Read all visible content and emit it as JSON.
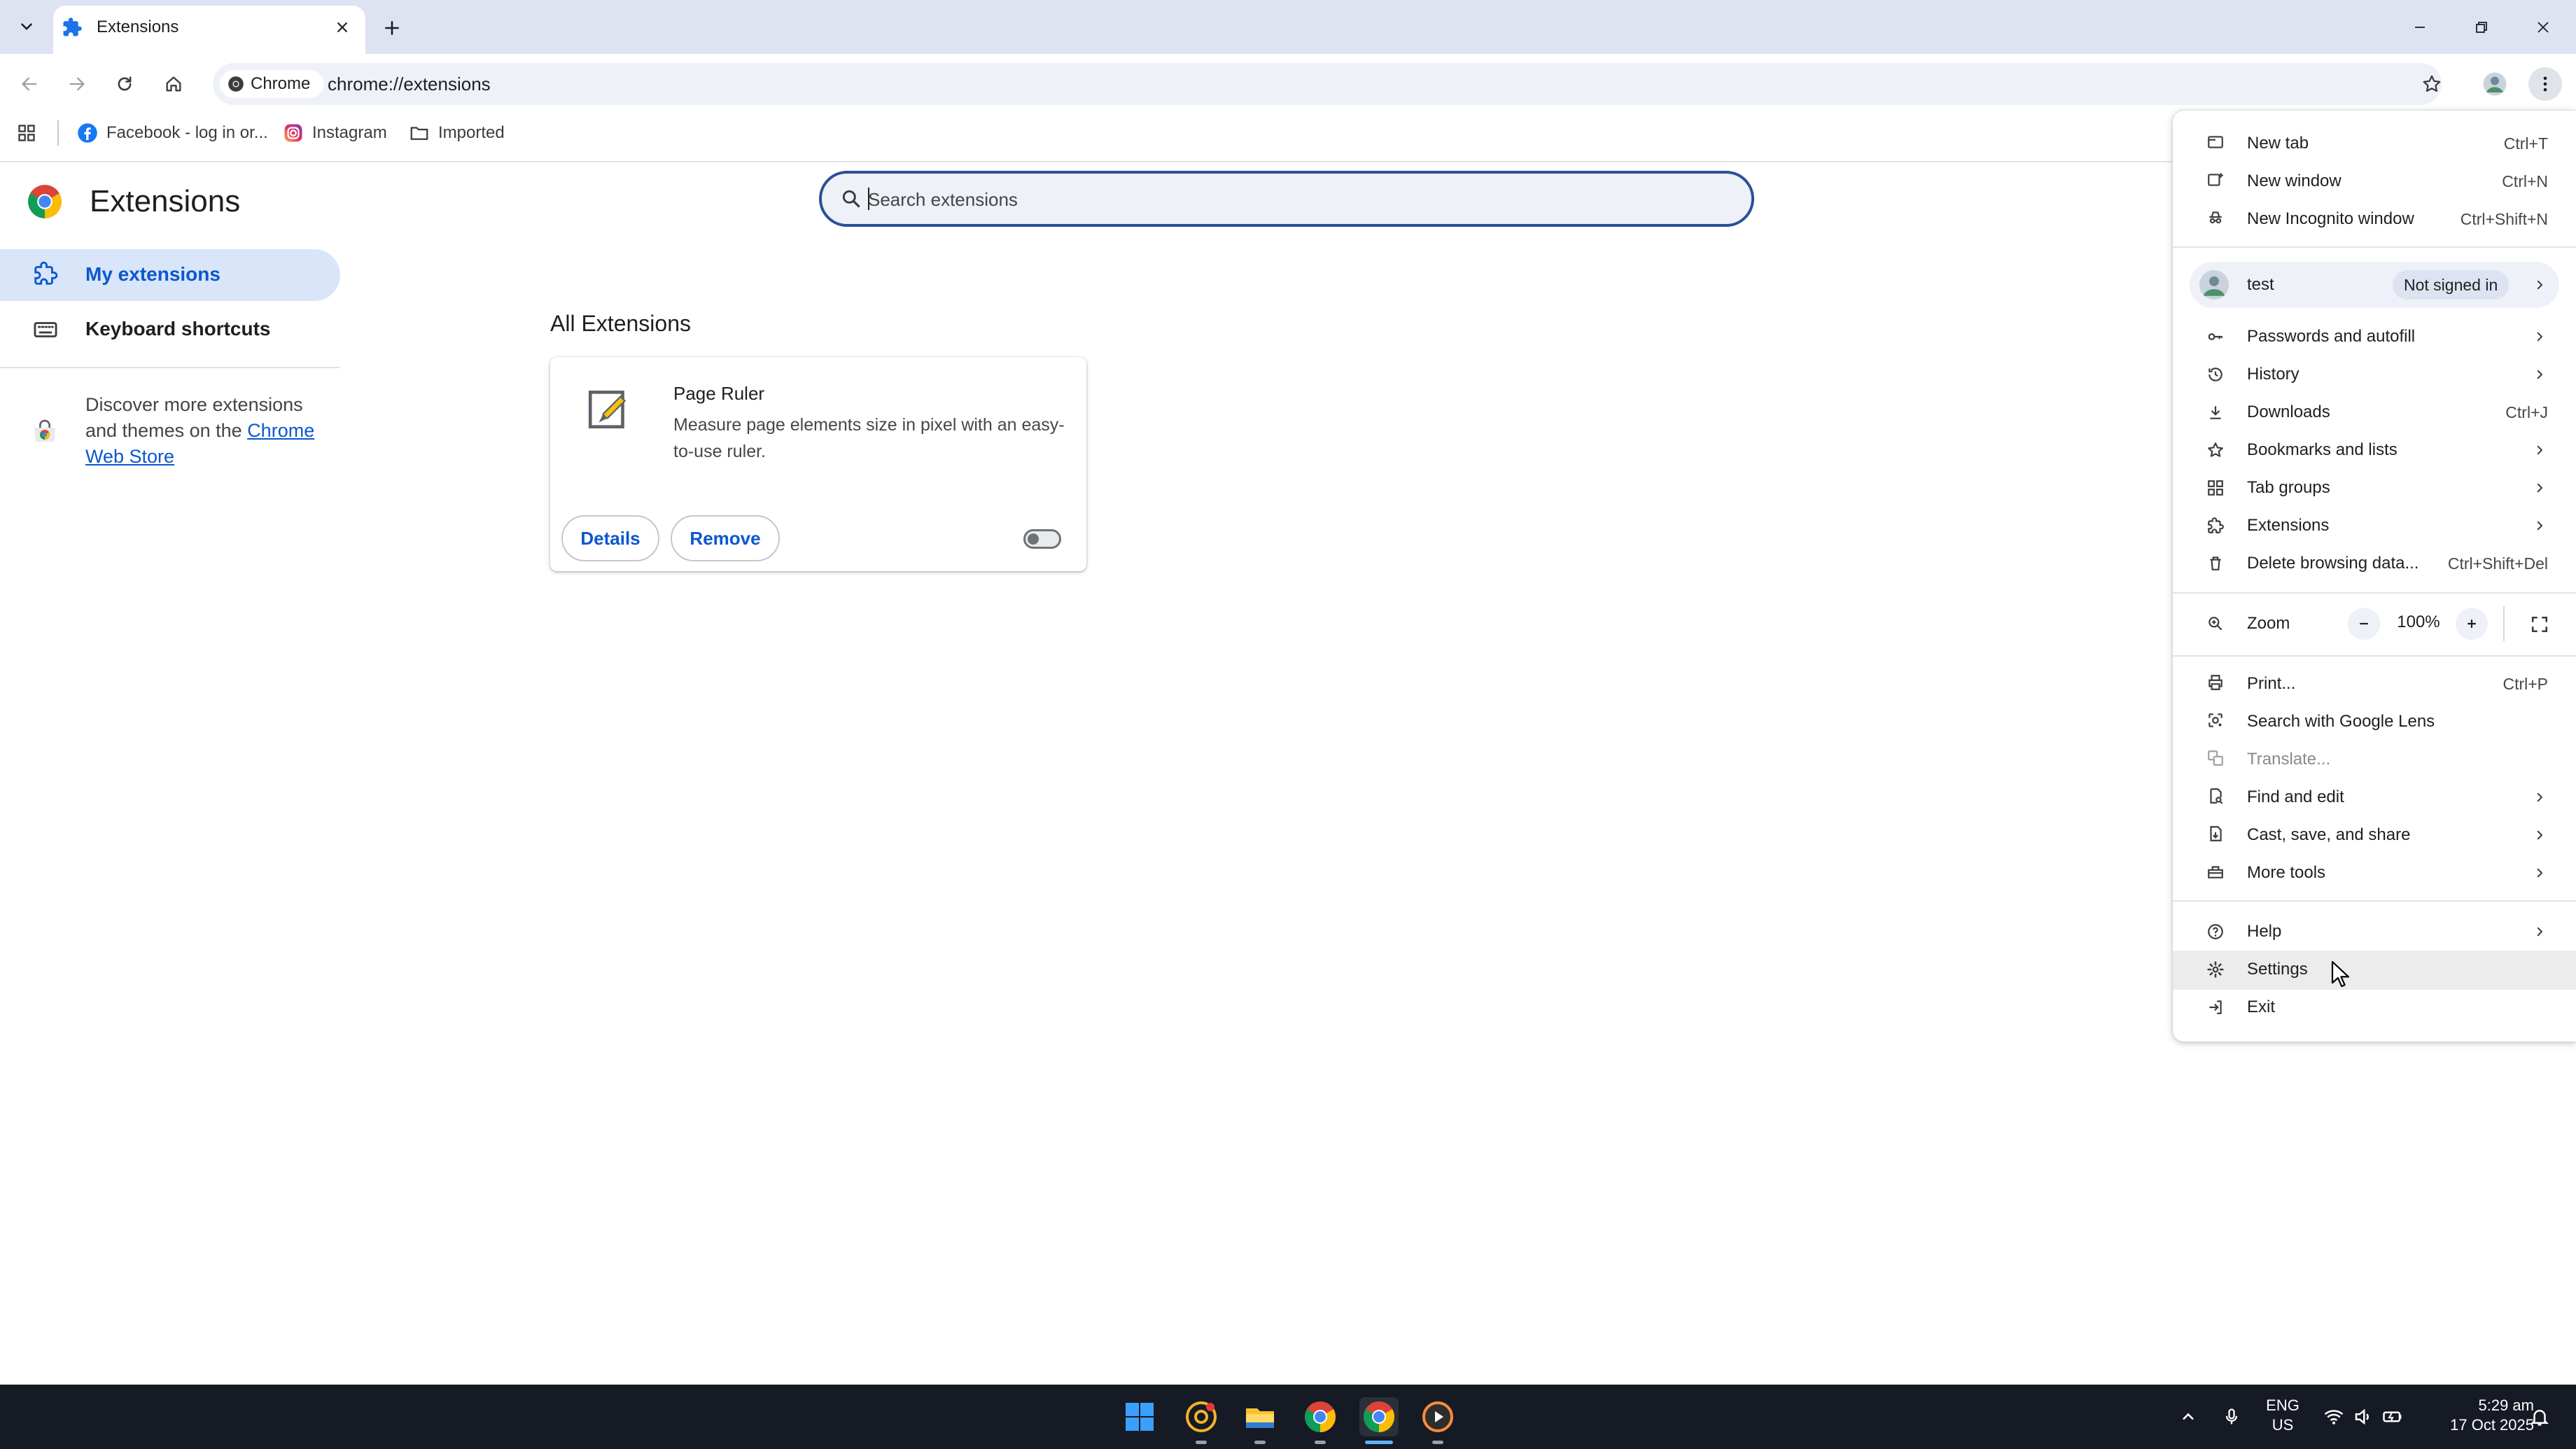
{
  "browser": {
    "tab": {
      "title": "Extensions"
    },
    "omnibox": {
      "chip_label": "Chrome",
      "url": "chrome://extensions"
    },
    "bookmarks": [
      {
        "label": "Facebook - log in or...",
        "icon": "facebook-icon"
      },
      {
        "label": "Instagram",
        "icon": "instagram-icon"
      },
      {
        "label": "Imported",
        "icon": "folder-icon"
      }
    ]
  },
  "page": {
    "title": "Extensions",
    "search_placeholder": "Search extensions",
    "nav": [
      {
        "label": "My extensions",
        "icon": "extensions-icon",
        "selected": true
      },
      {
        "label": "Keyboard shortcuts",
        "icon": "keyboard-icon",
        "selected": false
      }
    ],
    "discover_text": "Discover more extensions and themes on the",
    "webstore_link": "Chrome Web Store",
    "section_heading": "All Extensions",
    "extension_card": {
      "name": "Page Ruler",
      "description": "Measure page elements size in pixel with an easy-to-use ruler.",
      "details_label": "Details",
      "remove_label": "Remove",
      "enabled": false
    }
  },
  "menu": {
    "items": [
      {
        "key": "new_tab",
        "label": "New tab",
        "shortcut": "Ctrl+T",
        "icon": "new-tab-icon"
      },
      {
        "key": "new_window",
        "label": "New window",
        "shortcut": "Ctrl+N",
        "icon": "new-window-icon"
      },
      {
        "key": "incognito",
        "label": "New Incognito window",
        "shortcut": "Ctrl+Shift+N",
        "icon": "incognito-icon"
      },
      {
        "key": "passwords",
        "label": "Passwords and autofill",
        "icon": "key-icon"
      },
      {
        "key": "history",
        "label": "History",
        "icon": "history-icon"
      },
      {
        "key": "downloads",
        "label": "Downloads",
        "shortcut": "Ctrl+J",
        "icon": "download-icon"
      },
      {
        "key": "bookmarks",
        "label": "Bookmarks and lists",
        "icon": "star-icon"
      },
      {
        "key": "tab_groups",
        "label": "Tab groups",
        "icon": "tab-groups-icon"
      },
      {
        "key": "extensions",
        "label": "Extensions",
        "icon": "extensions-icon"
      },
      {
        "key": "delete_data",
        "label": "Delete browsing data...",
        "shortcut": "Ctrl+Shift+Del",
        "icon": "trash-icon"
      },
      {
        "key": "print",
        "label": "Print...",
        "shortcut": "Ctrl+P",
        "icon": "print-icon"
      },
      {
        "key": "lens",
        "label": "Search with Google Lens",
        "icon": "lens-icon"
      },
      {
        "key": "translate",
        "label": "Translate...",
        "icon": "translate-icon",
        "disabled": true
      },
      {
        "key": "find",
        "label": "Find and edit",
        "icon": "find-icon"
      },
      {
        "key": "cast",
        "label": "Cast, save, and share",
        "icon": "cast-icon"
      },
      {
        "key": "more_tools",
        "label": "More tools",
        "icon": "toolbox-icon"
      },
      {
        "key": "help",
        "label": "Help",
        "icon": "help-icon"
      },
      {
        "key": "settings",
        "label": "Settings",
        "icon": "gear-icon"
      },
      {
        "key": "exit",
        "label": "Exit",
        "icon": "exit-icon"
      }
    ],
    "profile": {
      "name": "test",
      "status": "Not signed in"
    },
    "zoom": {
      "label": "Zoom",
      "value": "100%",
      "minus": "−",
      "plus": "+"
    }
  },
  "taskbar": {
    "language": "ENG",
    "region": "US",
    "time": "5:29 am",
    "date": "17 Oct 2025",
    "apps": [
      "start-icon",
      "chrome-canary-icon",
      "file-explorer-icon",
      "chrome-icon",
      "chrome-icon",
      "media-player-icon"
    ]
  },
  "colors": {
    "accent": "#0b57d0",
    "search_border": "#2a4f98",
    "nav_selected_bg": "#d9e5f8",
    "tabstrip_bg": "#dde3f1",
    "taskbar_bg": "#161a24"
  }
}
